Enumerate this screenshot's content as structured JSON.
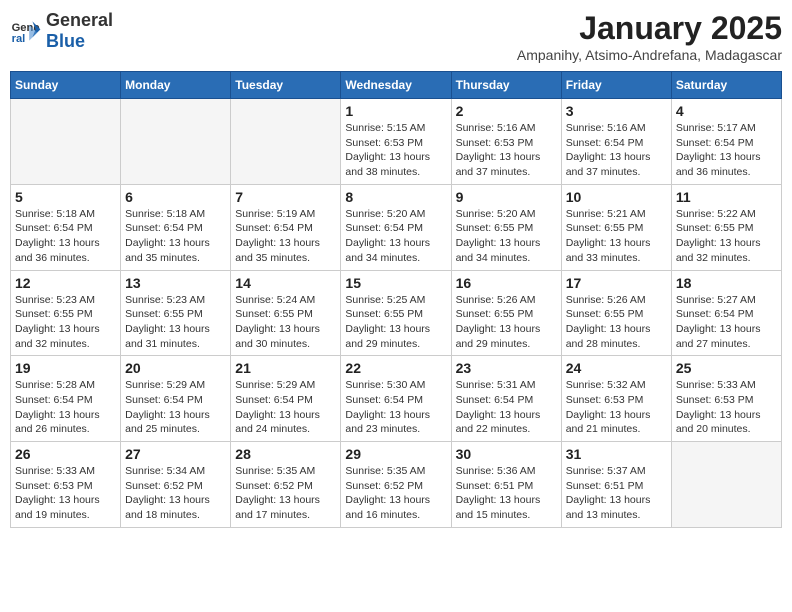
{
  "logo": {
    "general": "General",
    "blue": "Blue"
  },
  "title": {
    "month_year": "January 2025",
    "location": "Ampanihy, Atsimo-Andrefana, Madagascar"
  },
  "days_of_week": [
    "Sunday",
    "Monday",
    "Tuesday",
    "Wednesday",
    "Thursday",
    "Friday",
    "Saturday"
  ],
  "weeks": [
    [
      {
        "day": "",
        "sunrise": "",
        "sunset": "",
        "daylight": ""
      },
      {
        "day": "",
        "sunrise": "",
        "sunset": "",
        "daylight": ""
      },
      {
        "day": "",
        "sunrise": "",
        "sunset": "",
        "daylight": ""
      },
      {
        "day": "1",
        "sunrise": "Sunrise: 5:15 AM",
        "sunset": "Sunset: 6:53 PM",
        "daylight": "Daylight: 13 hours and 38 minutes."
      },
      {
        "day": "2",
        "sunrise": "Sunrise: 5:16 AM",
        "sunset": "Sunset: 6:53 PM",
        "daylight": "Daylight: 13 hours and 37 minutes."
      },
      {
        "day": "3",
        "sunrise": "Sunrise: 5:16 AM",
        "sunset": "Sunset: 6:54 PM",
        "daylight": "Daylight: 13 hours and 37 minutes."
      },
      {
        "day": "4",
        "sunrise": "Sunrise: 5:17 AM",
        "sunset": "Sunset: 6:54 PM",
        "daylight": "Daylight: 13 hours and 36 minutes."
      }
    ],
    [
      {
        "day": "5",
        "sunrise": "Sunrise: 5:18 AM",
        "sunset": "Sunset: 6:54 PM",
        "daylight": "Daylight: 13 hours and 36 minutes."
      },
      {
        "day": "6",
        "sunrise": "Sunrise: 5:18 AM",
        "sunset": "Sunset: 6:54 PM",
        "daylight": "Daylight: 13 hours and 35 minutes."
      },
      {
        "day": "7",
        "sunrise": "Sunrise: 5:19 AM",
        "sunset": "Sunset: 6:54 PM",
        "daylight": "Daylight: 13 hours and 35 minutes."
      },
      {
        "day": "8",
        "sunrise": "Sunrise: 5:20 AM",
        "sunset": "Sunset: 6:54 PM",
        "daylight": "Daylight: 13 hours and 34 minutes."
      },
      {
        "day": "9",
        "sunrise": "Sunrise: 5:20 AM",
        "sunset": "Sunset: 6:55 PM",
        "daylight": "Daylight: 13 hours and 34 minutes."
      },
      {
        "day": "10",
        "sunrise": "Sunrise: 5:21 AM",
        "sunset": "Sunset: 6:55 PM",
        "daylight": "Daylight: 13 hours and 33 minutes."
      },
      {
        "day": "11",
        "sunrise": "Sunrise: 5:22 AM",
        "sunset": "Sunset: 6:55 PM",
        "daylight": "Daylight: 13 hours and 32 minutes."
      }
    ],
    [
      {
        "day": "12",
        "sunrise": "Sunrise: 5:23 AM",
        "sunset": "Sunset: 6:55 PM",
        "daylight": "Daylight: 13 hours and 32 minutes."
      },
      {
        "day": "13",
        "sunrise": "Sunrise: 5:23 AM",
        "sunset": "Sunset: 6:55 PM",
        "daylight": "Daylight: 13 hours and 31 minutes."
      },
      {
        "day": "14",
        "sunrise": "Sunrise: 5:24 AM",
        "sunset": "Sunset: 6:55 PM",
        "daylight": "Daylight: 13 hours and 30 minutes."
      },
      {
        "day": "15",
        "sunrise": "Sunrise: 5:25 AM",
        "sunset": "Sunset: 6:55 PM",
        "daylight": "Daylight: 13 hours and 29 minutes."
      },
      {
        "day": "16",
        "sunrise": "Sunrise: 5:26 AM",
        "sunset": "Sunset: 6:55 PM",
        "daylight": "Daylight: 13 hours and 29 minutes."
      },
      {
        "day": "17",
        "sunrise": "Sunrise: 5:26 AM",
        "sunset": "Sunset: 6:55 PM",
        "daylight": "Daylight: 13 hours and 28 minutes."
      },
      {
        "day": "18",
        "sunrise": "Sunrise: 5:27 AM",
        "sunset": "Sunset: 6:54 PM",
        "daylight": "Daylight: 13 hours and 27 minutes."
      }
    ],
    [
      {
        "day": "19",
        "sunrise": "Sunrise: 5:28 AM",
        "sunset": "Sunset: 6:54 PM",
        "daylight": "Daylight: 13 hours and 26 minutes."
      },
      {
        "day": "20",
        "sunrise": "Sunrise: 5:29 AM",
        "sunset": "Sunset: 6:54 PM",
        "daylight": "Daylight: 13 hours and 25 minutes."
      },
      {
        "day": "21",
        "sunrise": "Sunrise: 5:29 AM",
        "sunset": "Sunset: 6:54 PM",
        "daylight": "Daylight: 13 hours and 24 minutes."
      },
      {
        "day": "22",
        "sunrise": "Sunrise: 5:30 AM",
        "sunset": "Sunset: 6:54 PM",
        "daylight": "Daylight: 13 hours and 23 minutes."
      },
      {
        "day": "23",
        "sunrise": "Sunrise: 5:31 AM",
        "sunset": "Sunset: 6:54 PM",
        "daylight": "Daylight: 13 hours and 22 minutes."
      },
      {
        "day": "24",
        "sunrise": "Sunrise: 5:32 AM",
        "sunset": "Sunset: 6:53 PM",
        "daylight": "Daylight: 13 hours and 21 minutes."
      },
      {
        "day": "25",
        "sunrise": "Sunrise: 5:33 AM",
        "sunset": "Sunset: 6:53 PM",
        "daylight": "Daylight: 13 hours and 20 minutes."
      }
    ],
    [
      {
        "day": "26",
        "sunrise": "Sunrise: 5:33 AM",
        "sunset": "Sunset: 6:53 PM",
        "daylight": "Daylight: 13 hours and 19 minutes."
      },
      {
        "day": "27",
        "sunrise": "Sunrise: 5:34 AM",
        "sunset": "Sunset: 6:52 PM",
        "daylight": "Daylight: 13 hours and 18 minutes."
      },
      {
        "day": "28",
        "sunrise": "Sunrise: 5:35 AM",
        "sunset": "Sunset: 6:52 PM",
        "daylight": "Daylight: 13 hours and 17 minutes."
      },
      {
        "day": "29",
        "sunrise": "Sunrise: 5:35 AM",
        "sunset": "Sunset: 6:52 PM",
        "daylight": "Daylight: 13 hours and 16 minutes."
      },
      {
        "day": "30",
        "sunrise": "Sunrise: 5:36 AM",
        "sunset": "Sunset: 6:51 PM",
        "daylight": "Daylight: 13 hours and 15 minutes."
      },
      {
        "day": "31",
        "sunrise": "Sunrise: 5:37 AM",
        "sunset": "Sunset: 6:51 PM",
        "daylight": "Daylight: 13 hours and 13 minutes."
      },
      {
        "day": "",
        "sunrise": "",
        "sunset": "",
        "daylight": ""
      }
    ]
  ]
}
